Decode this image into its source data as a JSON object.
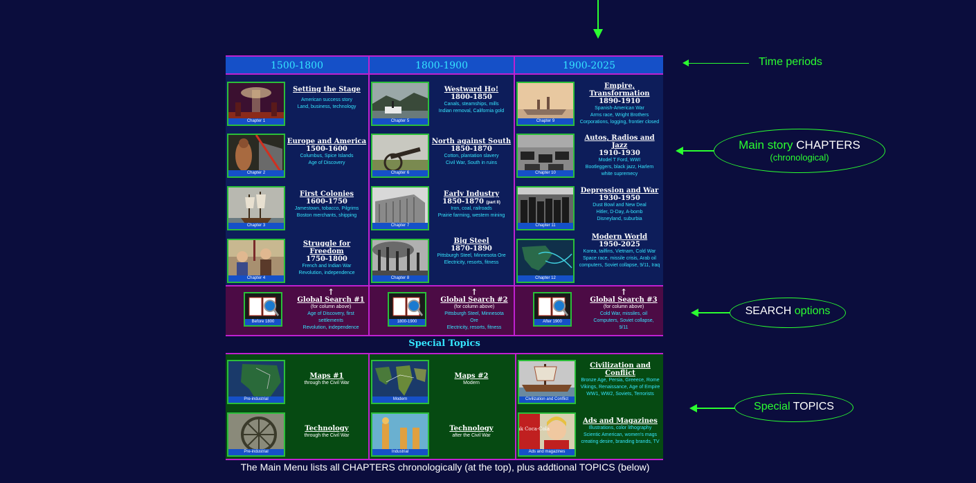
{
  "periods": [
    "1500-1800",
    "1800-1900",
    "1900-2025"
  ],
  "chapters": [
    {
      "cap": "Chapter 1",
      "title": "Setting the Stage",
      "dates": "",
      "desc": [
        "American success story",
        "Land, business, technology"
      ]
    },
    {
      "cap": "Chapter 5",
      "title": "Westward Ho!",
      "dates": "1800-1850",
      "desc": [
        "Canals, steamships, mills",
        "Indian removal, California gold"
      ]
    },
    {
      "cap": "Chapter 9",
      "title": "Empire, Transformation",
      "dates": "1890-1910",
      "desc": [
        "Spanish-American War",
        "Arms race, Wright Brothers",
        "Corporations, logging, frontier closed"
      ]
    },
    {
      "cap": "Chapter 2",
      "title": "Europe and America",
      "dates": "1500-1600",
      "desc": [
        "Columbus, Spice Islands",
        "Age of Discovery"
      ]
    },
    {
      "cap": "Chapter 6",
      "title": "North against South",
      "dates": "1850-1870",
      "desc": [
        "Cotton, plantation slavery",
        "Civil War, South in ruins"
      ]
    },
    {
      "cap": "Chapter 10",
      "title": "Autos, Radios and Jazz",
      "dates": "1910-1930",
      "desc": [
        "Model T Ford, WWI",
        "Bootleggers, black jazz, Harlem",
        "white supremecy"
      ]
    },
    {
      "cap": "Chapter 3",
      "title": "First Colonies",
      "dates": "1600-1750",
      "desc": [
        "Jamestown, tobacco, Pilgrims",
        "Boston merchants, shipping"
      ]
    },
    {
      "cap": "Chapter 7",
      "title": "Early Industry",
      "dates": "1850-1870",
      "dates_note": "(part II)",
      "desc": [
        "Iron, coal, railroads",
        "Prairie farming, western mining"
      ]
    },
    {
      "cap": "Chapter 11",
      "title": "Depression and War",
      "dates": "1930-1950",
      "desc": [
        "Dust Bowl and New Deal",
        "Hitler, D-Day, A-bomb",
        "Disneyland, suburbia"
      ]
    },
    {
      "cap": "Chapter 4",
      "title": "Struggle for Freedom",
      "dates": "1750-1800",
      "desc": [
        "French and Indian War",
        "Revolution, independence"
      ]
    },
    {
      "cap": "Chapter 8",
      "title": "Big Steel",
      "dates": "1870-1890",
      "desc": [
        "",
        "Pittsburgh Steel, Minnesota Ore",
        "Electricity, resorts, fitness"
      ]
    },
    {
      "cap": "Chapter 12",
      "title": "Modern World",
      "dates": "1950-2025",
      "desc": [
        "",
        "Korea, tailfins, Vietnam, Cold War",
        "Space race, missile crisis, Arab oil",
        "computers, Soviet collapse, 9/11, Iraq"
      ]
    }
  ],
  "searches": [
    {
      "cap": "Before 1800",
      "arrow": "↑",
      "title": "Global Search #1",
      "note": "(for column above)",
      "desc": [
        "Age of Discovery, first",
        "settlements",
        "Revolution, independence"
      ]
    },
    {
      "cap": "1800-1900",
      "arrow": "↑",
      "title": "Global Search #2",
      "note": "(for column above)",
      "desc": [
        "Pittsburgh Steel, Minnesota",
        "Ore",
        "Electricity, resorts, fitness"
      ]
    },
    {
      "cap": "After 1900",
      "arrow": "↑",
      "title": "Global Search #3",
      "note": "(for column above)",
      "desc": [
        "Cold War, missiles, oil",
        "Computers, Soviet collapse,",
        "9/11"
      ]
    }
  ],
  "special_title": "Special Topics",
  "topics": [
    {
      "cap": "Pre-industrial",
      "title": "Maps #1",
      "desc": [
        "through the Civil War"
      ]
    },
    {
      "cap": "Modern",
      "title": "Maps #2",
      "desc": [
        "Modern"
      ]
    },
    {
      "cap": "Civilization and Conflict",
      "title": "Civilization and Conflict",
      "desc": [
        "",
        "Bronze Age, Persia, Greeece, Rome",
        "Vikings, Renaissance, Age of Empire",
        "WW1, WW2, Soviets, Terrorists"
      ]
    },
    {
      "cap": "Pre-industrial",
      "title": "Technology",
      "desc": [
        "through the Civil War"
      ]
    },
    {
      "cap": "Industrial",
      "title": "Technology",
      "desc": [
        "after the Civil War"
      ]
    },
    {
      "cap": "Ads and magazines",
      "title": "Ads and Magazines",
      "desc": [
        "Illustrations, color lithography",
        "Scientic American, women's mags",
        "creating desire, branding brands, TV"
      ]
    }
  ],
  "ad_logo": "Drink Coca-Cola",
  "footer": "The Main Menu lists all CHAPTERS chronologically (at the top), plus addtional TOPICS (below)",
  "annotations": {
    "time": "Time periods",
    "main_a": "Main story",
    "main_b": "CHAPTERS",
    "main_c": "(chronological)",
    "search_a": "SEARCH",
    "search_b": "options",
    "special_a": "Special",
    "special_b": "TOPICS"
  }
}
